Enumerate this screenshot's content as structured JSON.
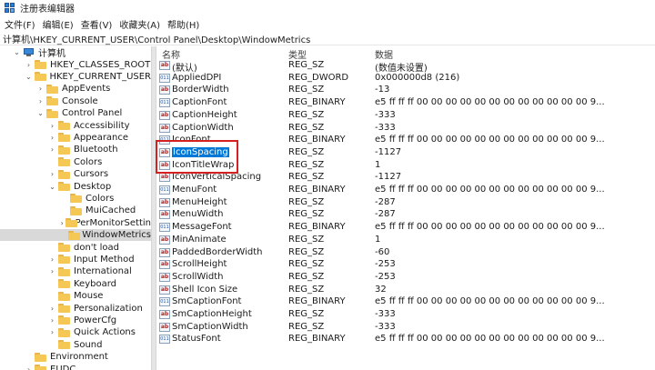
{
  "window": {
    "title": "注册表编辑器"
  },
  "menu": [
    "文件(F)",
    "编辑(E)",
    "查看(V)",
    "收藏夹(A)",
    "帮助(H)"
  ],
  "address": "计算机\\HKEY_CURRENT_USER\\Control Panel\\Desktop\\WindowMetrics",
  "tree": [
    {
      "label": "计算机",
      "chevron": "expanded",
      "icon": "computer-icon"
    },
    {
      "label": "HKEY_CLASSES_ROOT",
      "chevron": "collapsed",
      "icon": "folder-icon"
    },
    {
      "label": "HKEY_CURRENT_USER",
      "chevron": "expanded",
      "icon": "folder-icon"
    },
    {
      "label": "AppEvents",
      "chevron": "collapsed",
      "icon": "folder-icon"
    },
    {
      "label": "Console",
      "chevron": "collapsed",
      "icon": "folder-icon"
    },
    {
      "label": "Control Panel",
      "chevron": "expanded",
      "icon": "folder-icon"
    },
    {
      "label": "Accessibility",
      "chevron": "collapsed",
      "icon": "folder-icon"
    },
    {
      "label": "Appearance",
      "chevron": "collapsed",
      "icon": "folder-icon"
    },
    {
      "label": "Bluetooth",
      "chevron": "collapsed",
      "icon": "folder-icon"
    },
    {
      "label": "Colors",
      "chevron": "none",
      "icon": "folder-icon"
    },
    {
      "label": "Cursors",
      "chevron": "collapsed",
      "icon": "folder-icon"
    },
    {
      "label": "Desktop",
      "chevron": "expanded",
      "icon": "folder-icon"
    },
    {
      "label": "Colors",
      "chevron": "none",
      "icon": "folder-icon"
    },
    {
      "label": "MuiCached",
      "chevron": "none",
      "icon": "folder-icon"
    },
    {
      "label": "PerMonitorSettin",
      "chevron": "collapsed",
      "icon": "folder-icon"
    },
    {
      "label": "WindowMetrics",
      "chevron": "none",
      "icon": "folder-icon",
      "selected": true
    },
    {
      "label": "don't load",
      "chevron": "none",
      "icon": "folder-icon"
    },
    {
      "label": "Input Method",
      "chevron": "collapsed",
      "icon": "folder-icon"
    },
    {
      "label": "International",
      "chevron": "collapsed",
      "icon": "folder-icon"
    },
    {
      "label": "Keyboard",
      "chevron": "none",
      "icon": "folder-icon"
    },
    {
      "label": "Mouse",
      "chevron": "none",
      "icon": "folder-icon"
    },
    {
      "label": "Personalization",
      "chevron": "collapsed",
      "icon": "folder-icon"
    },
    {
      "label": "PowerCfg",
      "chevron": "collapsed",
      "icon": "folder-icon"
    },
    {
      "label": "Quick Actions",
      "chevron": "collapsed",
      "icon": "folder-icon"
    },
    {
      "label": "Sound",
      "chevron": "none",
      "icon": "folder-icon"
    },
    {
      "label": "Environment",
      "chevron": "none",
      "icon": "folder-icon"
    },
    {
      "label": "EUDC",
      "chevron": "collapsed",
      "icon": "folder-icon"
    }
  ],
  "columns": {
    "name": "名称",
    "type": "类型",
    "data": "数据"
  },
  "values": [
    {
      "name": "(默认)",
      "type": "REG_SZ",
      "data": "(数值未设置)",
      "kind": "sz"
    },
    {
      "name": "AppliedDPI",
      "type": "REG_DWORD",
      "data": "0x000000d8 (216)",
      "kind": "bin"
    },
    {
      "name": "BorderWidth",
      "type": "REG_SZ",
      "data": "-13",
      "kind": "sz"
    },
    {
      "name": "CaptionFont",
      "type": "REG_BINARY",
      "data": "e5 ff ff ff 00 00 00 00 00 00 00 00 00 00 00 00 9...",
      "kind": "bin"
    },
    {
      "name": "CaptionHeight",
      "type": "REG_SZ",
      "data": "-333",
      "kind": "sz"
    },
    {
      "name": "CaptionWidth",
      "type": "REG_SZ",
      "data": "-333",
      "kind": "sz"
    },
    {
      "name": "IconFont",
      "type": "REG_BINARY",
      "data": "e5 ff ff ff 00 00 00 00 00 00 00 00 00 00 00 00 9...",
      "kind": "bin"
    },
    {
      "name": "IconSpacing",
      "type": "REG_SZ",
      "data": "-1127",
      "kind": "sz",
      "selected": true
    },
    {
      "name": "IconTitleWrap",
      "type": "REG_SZ",
      "data": "1",
      "kind": "sz"
    },
    {
      "name": "IconVerticalSpacing",
      "type": "REG_SZ",
      "data": "-1127",
      "kind": "sz"
    },
    {
      "name": "MenuFont",
      "type": "REG_BINARY",
      "data": "e5 ff ff ff 00 00 00 00 00 00 00 00 00 00 00 00 9...",
      "kind": "bin"
    },
    {
      "name": "MenuHeight",
      "type": "REG_SZ",
      "data": "-287",
      "kind": "sz"
    },
    {
      "name": "MenuWidth",
      "type": "REG_SZ",
      "data": "-287",
      "kind": "sz"
    },
    {
      "name": "MessageFont",
      "type": "REG_BINARY",
      "data": "e5 ff ff ff 00 00 00 00 00 00 00 00 00 00 00 00 9...",
      "kind": "bin"
    },
    {
      "name": "MinAnimate",
      "type": "REG_SZ",
      "data": "1",
      "kind": "sz"
    },
    {
      "name": "PaddedBorderWidth",
      "type": "REG_SZ",
      "data": "-60",
      "kind": "sz"
    },
    {
      "name": "ScrollHeight",
      "type": "REG_SZ",
      "data": "-253",
      "kind": "sz"
    },
    {
      "name": "ScrollWidth",
      "type": "REG_SZ",
      "data": "-253",
      "kind": "sz"
    },
    {
      "name": "Shell Icon Size",
      "type": "REG_SZ",
      "data": "32",
      "kind": "sz"
    },
    {
      "name": "SmCaptionFont",
      "type": "REG_BINARY",
      "data": "e5 ff ff ff 00 00 00 00 00 00 00 00 00 00 00 00 9...",
      "kind": "bin"
    },
    {
      "name": "SmCaptionHeight",
      "type": "REG_SZ",
      "data": "-333",
      "kind": "sz"
    },
    {
      "name": "SmCaptionWidth",
      "type": "REG_SZ",
      "data": "-333",
      "kind": "sz"
    },
    {
      "name": "StatusFont",
      "type": "REG_BINARY",
      "data": "e5 ff ff ff 00 00 00 00 00 00 00 00 00 00 00 00 9...",
      "kind": "bin"
    }
  ],
  "colors": {
    "selection": "#0078d7",
    "highlight_box": "#d62020",
    "folder": "#f5c855"
  }
}
